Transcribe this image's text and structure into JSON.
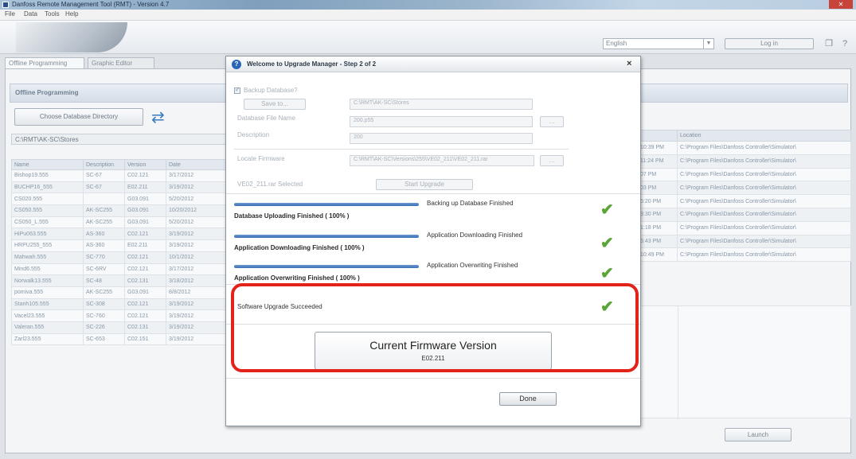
{
  "window": {
    "title": "Danfoss Remote Management Tool (RMT) - Version 4.7",
    "close_label": "✕"
  },
  "menu": [
    "File",
    "Data",
    "Tools",
    "Help"
  ],
  "header": {
    "language": "English",
    "login_label": "Log in"
  },
  "tabs": [
    "Offline Programming",
    "Graphic Editor"
  ],
  "offline": {
    "title": "Offline Programming",
    "choose_label": "Choose Database Directory",
    "db_path": "C:\\RMT\\AK-SC\\Stores"
  },
  "file_table": {
    "headers": [
      "Name",
      "Description",
      "Version",
      "Date"
    ],
    "rows": [
      [
        "Bishop19.555",
        "SC-67",
        "C02.121",
        "3/17/2012"
      ],
      [
        "BUCHP16_555",
        "SC-67",
        "E02.211",
        "3/19/2012"
      ],
      [
        "CS020.555",
        "",
        "G03.091",
        "5/20/2012"
      ],
      [
        "CS050.555",
        "AK-SC255",
        "G03.091",
        "10/20/2012"
      ],
      [
        "CS050_L.555",
        "AK-SC255",
        "G03.091",
        "5/20/2012"
      ],
      [
        "HiPu063.555",
        "AS-360",
        "C02.121",
        "3/19/2012"
      ],
      [
        "HRPU255_555",
        "AS-360",
        "E02.211",
        "3/19/2012"
      ],
      [
        "Mahwah.555",
        "SC-770",
        "C02.121",
        "10/1/2012"
      ],
      [
        "Mind6.555",
        "SC-6RV",
        "C02.121",
        "3/17/2012"
      ],
      [
        "Norwalk13.555",
        "SC-48",
        "C02.131",
        "3/18/2012"
      ],
      [
        "pomiva.555",
        "AK-SC255",
        "G03.091",
        "8/8/2012"
      ],
      [
        "Stanh105.555",
        "SC-308",
        "C02.121",
        "3/19/2012"
      ],
      [
        "Vacel23.555",
        "SC-760",
        "C02.121",
        "3/19/2012"
      ],
      [
        "Valeran.555",
        "SC-226",
        "C02.131",
        "3/19/2012"
      ],
      [
        "Zarl23.555",
        "SC-653",
        "C02.151",
        "3/19/2012"
      ]
    ]
  },
  "right_table": {
    "headers": [
      "",
      "Location"
    ],
    "rows": [
      [
        "10:39 PM",
        "C:\\Program Files\\Danfoss Controller\\Simulator\\"
      ],
      [
        "11:24 PM",
        "C:\\Program Files\\Danfoss Controller\\Simulator\\"
      ],
      [
        "07 PM",
        "C:\\Program Files\\Danfoss Controller\\Simulator\\"
      ],
      [
        "03 PM",
        "C:\\Program Files\\Danfoss Controller\\Simulator\\"
      ],
      [
        "5:20 PM",
        "C:\\Program Files\\Danfoss Controller\\Simulator\\"
      ],
      [
        "3:30 PM",
        "C:\\Program Files\\Danfoss Controller\\Simulator\\"
      ],
      [
        "1:18 PM",
        "C:\\Program Files\\Danfoss Controller\\Simulator\\"
      ],
      [
        "5:43 PM",
        "C:\\Program Files\\Danfoss Controller\\Simulator\\"
      ],
      [
        "10:49 PM",
        "C:\\Program Files\\Danfoss Controller\\Simulator\\"
      ]
    ]
  },
  "launch_label": "Launch",
  "dialog": {
    "title": "Welcome to Upgrade Manager - Step 2 of 2",
    "close": "×",
    "backup_label": "Backup Database?",
    "save_to_label": "Save to...",
    "save_to_path": "C:\\RMT\\AK-SC\\Stores",
    "db_file_name_label": "Database File Name",
    "db_file_name_value": "200.p55",
    "description_label": "Description",
    "description_value": "200",
    "locate_fw_label": "Locate Firmware",
    "locate_fw_path": "C:\\RMT\\AK-SC\\Versions\\255\\VE02_211\\VE02_211.rar",
    "selected_label": "VE02_211.rar Selected",
    "start_label": "Start Upgrade",
    "steps": [
      {
        "right": "Backing up Database Finished",
        "bold": "Database Uploading Finished  ( 100% )"
      },
      {
        "right": "Application Downloading Finished",
        "bold": "Application Downloading Finished  ( 100% )"
      },
      {
        "right": "Application Overwriting Finished",
        "bold": "Application Overwriting Finished  ( 100% )"
      }
    ],
    "success_text": "Software Upgrade Succeeded",
    "fw_title": "Current Firmware Version",
    "fw_value": "E02.211",
    "done_label": "Done"
  }
}
